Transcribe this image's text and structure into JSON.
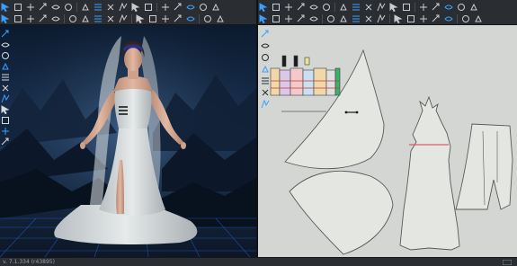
{
  "app": {
    "version_text": "v. 7.1.334 (r43895)"
  },
  "toolbar_3d": {
    "row1_icons": [
      "select-icon",
      "transform-icon",
      "move-icon",
      "arrow-icon",
      "sewing-icon",
      "fold-icon",
      "pin-icon",
      "tack-icon",
      "move-pin-icon",
      "brush-icon",
      "fabric-icon",
      "pattern-icon",
      "zipper-icon",
      "button-icon",
      "buttonhole-icon",
      "trim-icon",
      "measure-icon",
      "avatar-icon",
      "camera-icon",
      "grid-icon",
      "record-icon"
    ],
    "row2_icons": [
      "simulate-icon",
      "pencil-icon",
      "sew-icon",
      "fold-icon",
      "topstitch-icon",
      "puckering-icon",
      "elastic-icon",
      "strap-icon",
      "piping-icon",
      "pattern-icon",
      "hanger-icon",
      "scissors-icon",
      "lasso-icon",
      "pin-icon",
      "sparkle-icon",
      "star-icon",
      "arrange-icon",
      "snap-icon",
      "zoom-icon"
    ]
  },
  "toolbar_2d": {
    "row1_icons": [
      "select-icon",
      "transform-icon",
      "edit-point-icon",
      "curve-icon",
      "add-point-icon",
      "rectangle-icon",
      "circle-icon",
      "polygon-icon",
      "internal-line-icon",
      "dart-icon",
      "pleat-icon",
      "seam-allowance-icon",
      "symmetry-icon",
      "unfold-icon",
      "trace-icon",
      "grid-icon",
      "text-icon",
      "image-icon",
      "settings-icon"
    ],
    "row2_icons": [
      "segment-sew-icon",
      "free-sew-icon",
      "multi-sew-icon",
      "check-sew-icon",
      "tack-icon",
      "pin-icon",
      "fold-icon",
      "zipper-icon",
      "elastic-icon",
      "gather-icon",
      "topstitch-icon",
      "puckering-icon",
      "binding-icon",
      "grain-icon",
      "pattern-icon",
      "texture-icon",
      "graphic-icon",
      "layout-icon",
      "cut-icon",
      "measure-icon"
    ]
  },
  "side_tools_3d": [
    "avatar-visibility-icon",
    "garment-display-icon",
    "fabric-display-icon",
    "hanger-icon",
    "pin-visibility-icon",
    "texture-icon",
    "sewing-line-icon",
    "light-icon",
    "avatar-icon",
    "camera-icon",
    "measure-icon"
  ],
  "side_tools_2d": [
    "pattern-visibility-icon",
    "grain-line-icon",
    "sewing-display-icon",
    "texture-display-icon",
    "layout-icon",
    "notch-icon",
    "grade-icon"
  ],
  "colors": {
    "accent": "#3aa0ff",
    "board_background": "#d4d6d4",
    "pattern_fill": "#e4e6e2",
    "pattern_stroke": "#555a58",
    "seam_highlight": "#e05a6a",
    "grid_blue": "#2a7fff"
  }
}
